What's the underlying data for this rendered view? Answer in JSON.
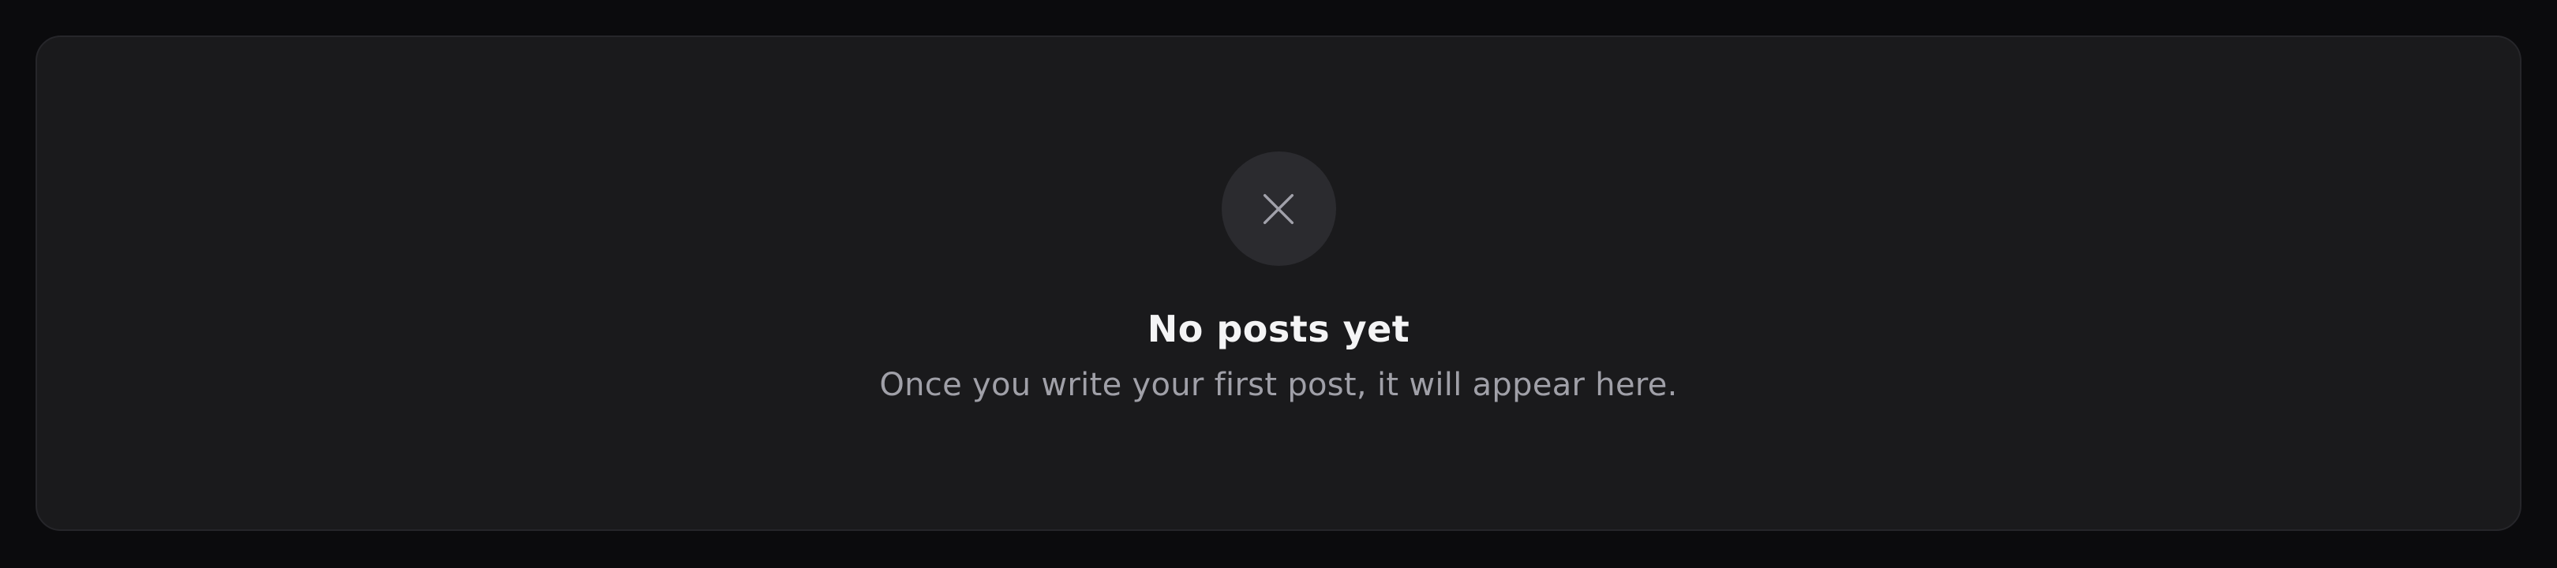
{
  "empty_state": {
    "icon": "close-icon",
    "title": "No posts yet",
    "message": "Once you write your first post, it will appear here."
  },
  "colors": {
    "page_background": "#0b0b0d",
    "card_background": "#1a1a1c",
    "icon_circle": "#2b2b2f",
    "icon_stroke": "#a1a1aa",
    "title_text": "#f4f4f5",
    "message_text": "#a0a0a8"
  }
}
